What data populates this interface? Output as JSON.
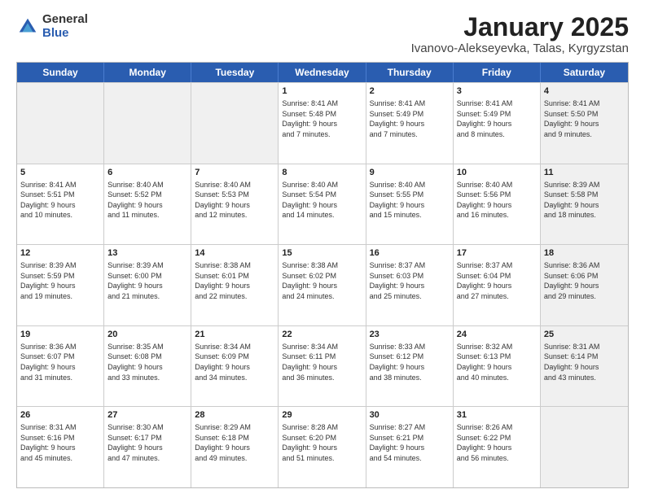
{
  "logo": {
    "general": "General",
    "blue": "Blue"
  },
  "title": {
    "month": "January 2025",
    "location": "Ivanovo-Alekseyevka, Talas, Kyrgyzstan"
  },
  "header_days": [
    "Sunday",
    "Monday",
    "Tuesday",
    "Wednesday",
    "Thursday",
    "Friday",
    "Saturday"
  ],
  "weeks": [
    [
      {
        "day": "",
        "info": "",
        "shaded": true
      },
      {
        "day": "",
        "info": "",
        "shaded": true
      },
      {
        "day": "",
        "info": "",
        "shaded": true
      },
      {
        "day": "1",
        "info": "Sunrise: 8:41 AM\nSunset: 5:48 PM\nDaylight: 9 hours\nand 7 minutes."
      },
      {
        "day": "2",
        "info": "Sunrise: 8:41 AM\nSunset: 5:49 PM\nDaylight: 9 hours\nand 7 minutes."
      },
      {
        "day": "3",
        "info": "Sunrise: 8:41 AM\nSunset: 5:49 PM\nDaylight: 9 hours\nand 8 minutes."
      },
      {
        "day": "4",
        "info": "Sunrise: 8:41 AM\nSunset: 5:50 PM\nDaylight: 9 hours\nand 9 minutes.",
        "shaded": true
      }
    ],
    [
      {
        "day": "5",
        "info": "Sunrise: 8:41 AM\nSunset: 5:51 PM\nDaylight: 9 hours\nand 10 minutes."
      },
      {
        "day": "6",
        "info": "Sunrise: 8:40 AM\nSunset: 5:52 PM\nDaylight: 9 hours\nand 11 minutes."
      },
      {
        "day": "7",
        "info": "Sunrise: 8:40 AM\nSunset: 5:53 PM\nDaylight: 9 hours\nand 12 minutes."
      },
      {
        "day": "8",
        "info": "Sunrise: 8:40 AM\nSunset: 5:54 PM\nDaylight: 9 hours\nand 14 minutes."
      },
      {
        "day": "9",
        "info": "Sunrise: 8:40 AM\nSunset: 5:55 PM\nDaylight: 9 hours\nand 15 minutes."
      },
      {
        "day": "10",
        "info": "Sunrise: 8:40 AM\nSunset: 5:56 PM\nDaylight: 9 hours\nand 16 minutes."
      },
      {
        "day": "11",
        "info": "Sunrise: 8:39 AM\nSunset: 5:58 PM\nDaylight: 9 hours\nand 18 minutes.",
        "shaded": true
      }
    ],
    [
      {
        "day": "12",
        "info": "Sunrise: 8:39 AM\nSunset: 5:59 PM\nDaylight: 9 hours\nand 19 minutes."
      },
      {
        "day": "13",
        "info": "Sunrise: 8:39 AM\nSunset: 6:00 PM\nDaylight: 9 hours\nand 21 minutes."
      },
      {
        "day": "14",
        "info": "Sunrise: 8:38 AM\nSunset: 6:01 PM\nDaylight: 9 hours\nand 22 minutes."
      },
      {
        "day": "15",
        "info": "Sunrise: 8:38 AM\nSunset: 6:02 PM\nDaylight: 9 hours\nand 24 minutes."
      },
      {
        "day": "16",
        "info": "Sunrise: 8:37 AM\nSunset: 6:03 PM\nDaylight: 9 hours\nand 25 minutes."
      },
      {
        "day": "17",
        "info": "Sunrise: 8:37 AM\nSunset: 6:04 PM\nDaylight: 9 hours\nand 27 minutes."
      },
      {
        "day": "18",
        "info": "Sunrise: 8:36 AM\nSunset: 6:06 PM\nDaylight: 9 hours\nand 29 minutes.",
        "shaded": true
      }
    ],
    [
      {
        "day": "19",
        "info": "Sunrise: 8:36 AM\nSunset: 6:07 PM\nDaylight: 9 hours\nand 31 minutes."
      },
      {
        "day": "20",
        "info": "Sunrise: 8:35 AM\nSunset: 6:08 PM\nDaylight: 9 hours\nand 33 minutes."
      },
      {
        "day": "21",
        "info": "Sunrise: 8:34 AM\nSunset: 6:09 PM\nDaylight: 9 hours\nand 34 minutes."
      },
      {
        "day": "22",
        "info": "Sunrise: 8:34 AM\nSunset: 6:11 PM\nDaylight: 9 hours\nand 36 minutes."
      },
      {
        "day": "23",
        "info": "Sunrise: 8:33 AM\nSunset: 6:12 PM\nDaylight: 9 hours\nand 38 minutes."
      },
      {
        "day": "24",
        "info": "Sunrise: 8:32 AM\nSunset: 6:13 PM\nDaylight: 9 hours\nand 40 minutes."
      },
      {
        "day": "25",
        "info": "Sunrise: 8:31 AM\nSunset: 6:14 PM\nDaylight: 9 hours\nand 43 minutes.",
        "shaded": true
      }
    ],
    [
      {
        "day": "26",
        "info": "Sunrise: 8:31 AM\nSunset: 6:16 PM\nDaylight: 9 hours\nand 45 minutes."
      },
      {
        "day": "27",
        "info": "Sunrise: 8:30 AM\nSunset: 6:17 PM\nDaylight: 9 hours\nand 47 minutes."
      },
      {
        "day": "28",
        "info": "Sunrise: 8:29 AM\nSunset: 6:18 PM\nDaylight: 9 hours\nand 49 minutes."
      },
      {
        "day": "29",
        "info": "Sunrise: 8:28 AM\nSunset: 6:20 PM\nDaylight: 9 hours\nand 51 minutes."
      },
      {
        "day": "30",
        "info": "Sunrise: 8:27 AM\nSunset: 6:21 PM\nDaylight: 9 hours\nand 54 minutes."
      },
      {
        "day": "31",
        "info": "Sunrise: 8:26 AM\nSunset: 6:22 PM\nDaylight: 9 hours\nand 56 minutes."
      },
      {
        "day": "",
        "info": "",
        "shaded": true
      }
    ]
  ]
}
